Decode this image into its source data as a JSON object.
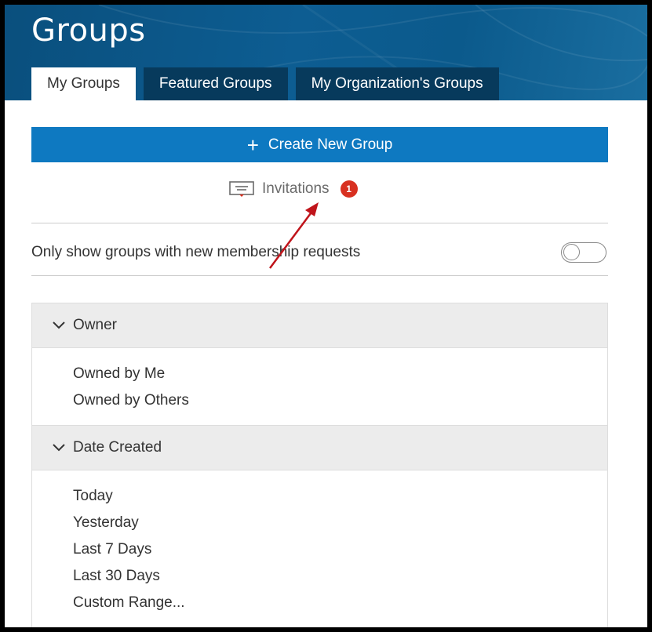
{
  "header": {
    "title": "Groups",
    "tabs": [
      {
        "label": "My Groups",
        "active": true
      },
      {
        "label": "Featured Groups",
        "active": false
      },
      {
        "label": "My Organization's Groups",
        "active": false
      }
    ]
  },
  "actions": {
    "create_label": "Create New Group",
    "create_icon": "plus-icon",
    "invitations_label": "Invitations",
    "invitations_icon": "invitation-icon",
    "invitations_count": "1"
  },
  "toggle": {
    "label": "Only show groups with new membership requests",
    "on": false
  },
  "filters": [
    {
      "label": "Owner",
      "items": [
        "Owned by Me",
        "Owned by Others"
      ]
    },
    {
      "label": "Date Created",
      "items": [
        "Today",
        "Yesterday",
        "Last 7 Days",
        "Last 30 Days",
        "Custom Range..."
      ]
    }
  ],
  "colors": {
    "banner": "#0b5a8c",
    "primary_button": "#0e79c1",
    "badge": "#d83020",
    "annotation_arrow": "#c0141b"
  }
}
